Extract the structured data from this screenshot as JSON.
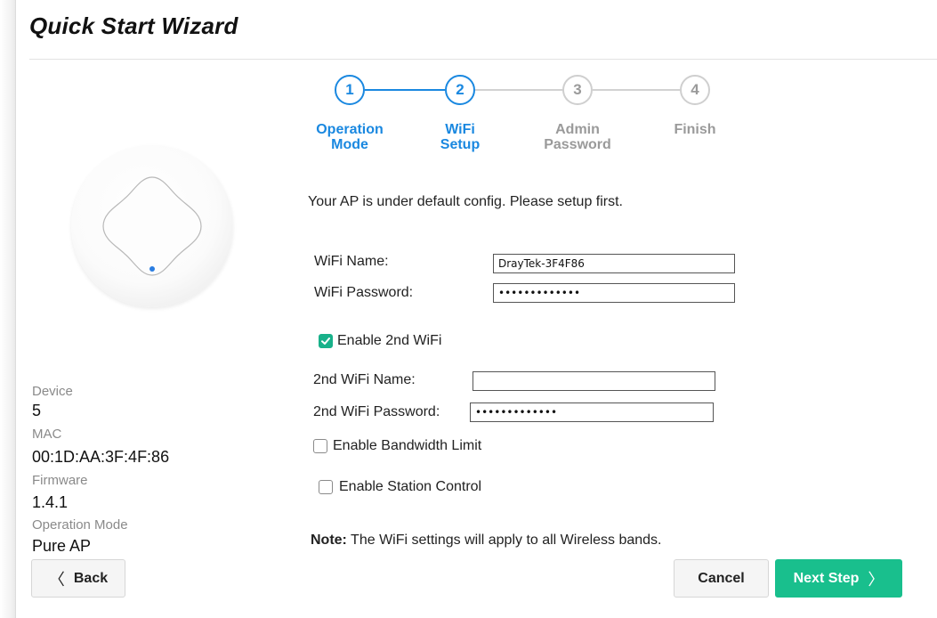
{
  "title": "Quick Start Wizard",
  "steps": [
    {
      "number": "1",
      "label_line1": "Operation",
      "label_line2": "Mode",
      "state": "done"
    },
    {
      "number": "2",
      "label_line1": "WiFi",
      "label_line2": "Setup",
      "state": "current"
    },
    {
      "number": "3",
      "label_line1": "Admin",
      "label_line2": "Password",
      "state": "pending"
    },
    {
      "number": "4",
      "label_line1": "Finish",
      "label_line2": "",
      "state": "pending"
    }
  ],
  "device_info": {
    "device_label": "Device",
    "device_value": "5",
    "mac_label": "MAC",
    "mac_value": "00:1D:AA:3F:4F:86",
    "firmware_label": "Firmware",
    "firmware_value": "1.4.1",
    "mode_label": "Operation Mode",
    "mode_value": "Pure AP"
  },
  "form": {
    "intro": "Your AP is under default config. Please setup first.",
    "wifi_name_label": "WiFi Name:",
    "wifi_name_value": "DrayTek-3F4F86",
    "wifi_password_label": "WiFi Password:",
    "wifi_password_value": "•••••••••••••",
    "enable_2nd_wifi_label": "Enable 2nd WiFi",
    "enable_2nd_wifi_checked": true,
    "wifi2_name_label": "2nd WiFi Name:",
    "wifi2_name_value": "",
    "wifi2_password_label": "2nd WiFi Password:",
    "wifi2_password_value": "•••••••••••••",
    "bandwidth_limit_label": "Enable Bandwidth Limit",
    "bandwidth_limit_checked": false,
    "station_control_label": "Enable Station Control",
    "station_control_checked": false,
    "note_prefix": "Note:",
    "note_text": " The WiFi settings will apply to all Wireless bands."
  },
  "buttons": {
    "back_chevron": "〈",
    "back_label": "Back",
    "cancel_label": "Cancel",
    "next_label": "Next Step",
    "next_chevron": "〉"
  },
  "colors": {
    "accent_blue": "#1a88e0",
    "inactive_gray": "#9a9a9a",
    "primary_green": "#19bf8d",
    "checkbox_green": "#18b18a"
  },
  "icons": {
    "device": "access-point-device-icon",
    "checkmark": "checkmark-icon"
  }
}
